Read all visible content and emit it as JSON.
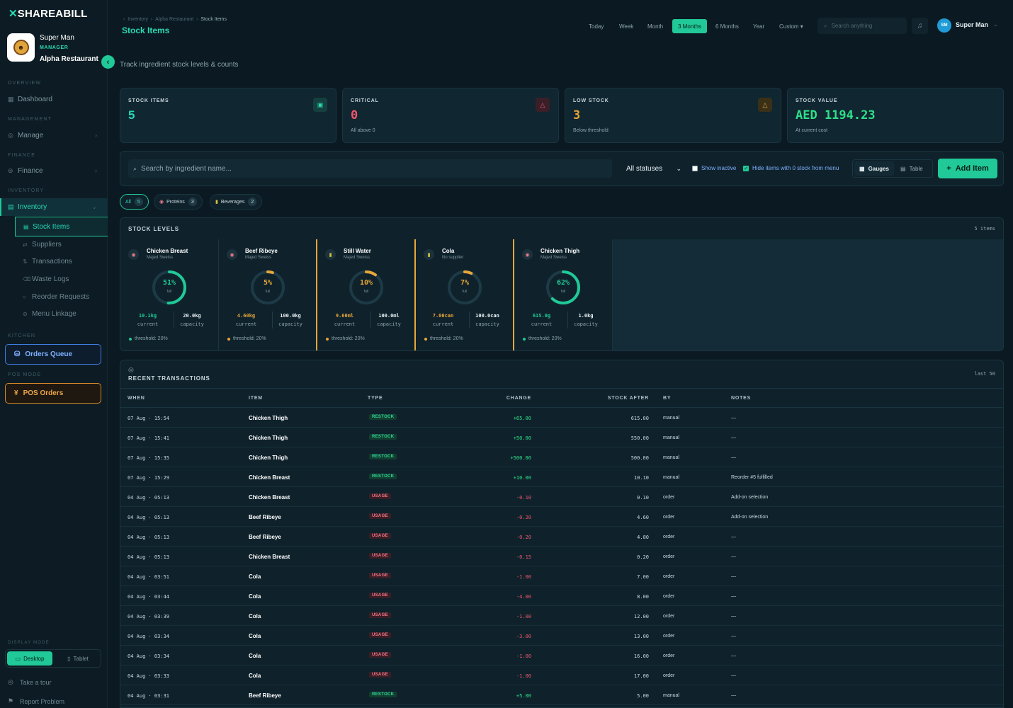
{
  "app": {
    "logo_mark": "✕",
    "logo_text": "SHAREABILL"
  },
  "profile": {
    "name": "Super Man",
    "role": "MANAGER",
    "restaurant": "Alpha Restaurant"
  },
  "sidebar": {
    "overview_label": "OVERVIEW",
    "dashboard": "Dashboard",
    "management_label": "MANAGEMENT",
    "manage": "Manage",
    "finance_label": "FINANCE",
    "finance": "Finance",
    "inventory_label": "INVENTORY",
    "inventory": "Inventory",
    "sub_items": [
      "Stock Items",
      "Suppliers",
      "Transactions",
      "Waste Logs",
      "Reorder Requests",
      "Menu Linkage"
    ],
    "kitchen_label": "KITCHEN",
    "orders_queue": "Orders Queue",
    "pos_label": "POS MODE",
    "pos_orders": "POS Orders",
    "display_label": "DISPLAY MODE",
    "desktop": "Desktop",
    "tablet": "Tablet",
    "tour": "Take a tour",
    "report": "Report Problem"
  },
  "header": {
    "breadcrumbs": [
      "Inventory",
      "Alpha Restaurant",
      "Stock Items"
    ],
    "title": "Stock Items",
    "subtitle": "Track ingredient stock levels & counts",
    "ranges": [
      "Today",
      "Week",
      "Month",
      "3 Months",
      "6 Months",
      "Year",
      "Custom ▾"
    ],
    "active_range": "3 Months",
    "search_placeholder": "Search anything",
    "user_initials": "SM",
    "user_name": "Super Man"
  },
  "stats": [
    {
      "label": "STOCK ITEMS",
      "value": "5",
      "caption": "",
      "color": "#2ad8b4"
    },
    {
      "label": "CRITICAL",
      "value": "0",
      "caption": "All above 0",
      "color": "#f0566e"
    },
    {
      "label": "LOW STOCK",
      "value": "3",
      "caption": "Below threshold",
      "color": "#e7a63a"
    },
    {
      "label": "STOCK VALUE",
      "value": "AED 1194.23",
      "caption": "At current cost",
      "color": "#2ee08a"
    }
  ],
  "filters": {
    "search_placeholder": "Search by ingredient name...",
    "status": "All statuses",
    "show_inactive": "Show inactive",
    "hide_zero": "Hide items with 0 stock from menu",
    "gauges": "Gauges",
    "table": "Table",
    "add_item": "Add Item"
  },
  "pills": [
    {
      "label": "All",
      "count": "5"
    },
    {
      "label": "Proteins",
      "count": "3"
    },
    {
      "label": "Beverages",
      "count": "2"
    }
  ],
  "stock_levels": {
    "title": "STOCK LEVELS",
    "count": "5 items",
    "full_label": "full",
    "current_label": "current",
    "capacity_label": "capacity",
    "items": [
      {
        "name": "Chicken Breast",
        "supplier": "Majed Sweiss",
        "pct": "51%",
        "fraction": 0.51,
        "current": "10.1kg",
        "capacity": "20.0kg",
        "threshold": "threshold: 20%",
        "low": false
      },
      {
        "name": "Beef Ribeye",
        "supplier": "Majed Sweiss",
        "pct": "5%",
        "fraction": 0.05,
        "current": "4.60kg",
        "capacity": "100.0kg",
        "threshold": "threshold: 20%",
        "low": true
      },
      {
        "name": "Still Water",
        "supplier": "Majed Sweiss",
        "pct": "10%",
        "fraction": 0.1,
        "current": "9.60ml",
        "capacity": "100.0ml",
        "threshold": "threshold: 20%",
        "low": true
      },
      {
        "name": "Cola",
        "supplier": "No supplier",
        "pct": "7%",
        "fraction": 0.07,
        "current": "7.00can",
        "capacity": "100.0can",
        "threshold": "threshold: 20%",
        "low": true
      },
      {
        "name": "Chicken Thigh",
        "supplier": "Majed Sweiss",
        "pct": "62%",
        "fraction": 0.62,
        "current": "615.0g",
        "capacity": "1.0kg",
        "threshold": "threshold: 20%",
        "low": false
      }
    ]
  },
  "transactions": {
    "title": "RECENT TRANSACTIONS",
    "last": "last 50",
    "columns": [
      "WHEN",
      "ITEM",
      "TYPE",
      "CHANGE",
      "STOCK AFTER",
      "BY",
      "NOTES"
    ],
    "rows": [
      {
        "when": "07 Aug · 15:54",
        "item": "Chicken Thigh",
        "type": "RESTOCK",
        "change": "+65.00",
        "after": "615.00",
        "by": "manual",
        "notes": "—"
      },
      {
        "when": "07 Aug · 15:41",
        "item": "Chicken Thigh",
        "type": "RESTOCK",
        "change": "+50.00",
        "after": "550.00",
        "by": "manual",
        "notes": "—"
      },
      {
        "when": "07 Aug · 15:35",
        "item": "Chicken Thigh",
        "type": "RESTOCK",
        "change": "+500.00",
        "after": "500.00",
        "by": "manual",
        "notes": "—"
      },
      {
        "when": "07 Aug · 15:29",
        "item": "Chicken Breast",
        "type": "RESTOCK",
        "change": "+10.00",
        "after": "10.10",
        "by": "manual",
        "notes": "Reorder #5 fulfilled"
      },
      {
        "when": "04 Aug · 05:13",
        "item": "Chicken Breast",
        "type": "USAGE",
        "change": "-0.10",
        "after": "0.10",
        "by": "order",
        "notes": "Add-on selection"
      },
      {
        "when": "04 Aug · 05:13",
        "item": "Beef Ribeye",
        "type": "USAGE",
        "change": "-0.20",
        "after": "4.60",
        "by": "order",
        "notes": "Add-on selection"
      },
      {
        "when": "04 Aug · 05:13",
        "item": "Beef Ribeye",
        "type": "USAGE",
        "change": "-0.20",
        "after": "4.80",
        "by": "order",
        "notes": "—"
      },
      {
        "when": "04 Aug · 05:13",
        "item": "Chicken Breast",
        "type": "USAGE",
        "change": "-0.15",
        "after": "0.20",
        "by": "order",
        "notes": "—"
      },
      {
        "when": "04 Aug · 03:51",
        "item": "Cola",
        "type": "USAGE",
        "change": "-1.00",
        "after": "7.00",
        "by": "order",
        "notes": "—"
      },
      {
        "when": "04 Aug · 03:44",
        "item": "Cola",
        "type": "USAGE",
        "change": "-4.00",
        "after": "8.00",
        "by": "order",
        "notes": "—"
      },
      {
        "when": "04 Aug · 03:39",
        "item": "Cola",
        "type": "USAGE",
        "change": "-1.00",
        "after": "12.00",
        "by": "order",
        "notes": "—"
      },
      {
        "when": "04 Aug · 03:34",
        "item": "Cola",
        "type": "USAGE",
        "change": "-3.00",
        "after": "13.00",
        "by": "order",
        "notes": "—"
      },
      {
        "when": "04 Aug · 03:34",
        "item": "Cola",
        "type": "USAGE",
        "change": "-1.00",
        "after": "16.00",
        "by": "order",
        "notes": "—"
      },
      {
        "when": "04 Aug · 03:33",
        "item": "Cola",
        "type": "USAGE",
        "change": "-1.00",
        "after": "17.00",
        "by": "order",
        "notes": "—"
      },
      {
        "when": "04 Aug · 03:31",
        "item": "Beef Ribeye",
        "type": "RESTOCK",
        "change": "+5.00",
        "after": "5.00",
        "by": "manual",
        "notes": "—"
      }
    ]
  },
  "colors": {
    "accent": "#20c997",
    "warning": "#e7a63a",
    "danger": "#f0566e",
    "positive": "#2ee08a"
  }
}
